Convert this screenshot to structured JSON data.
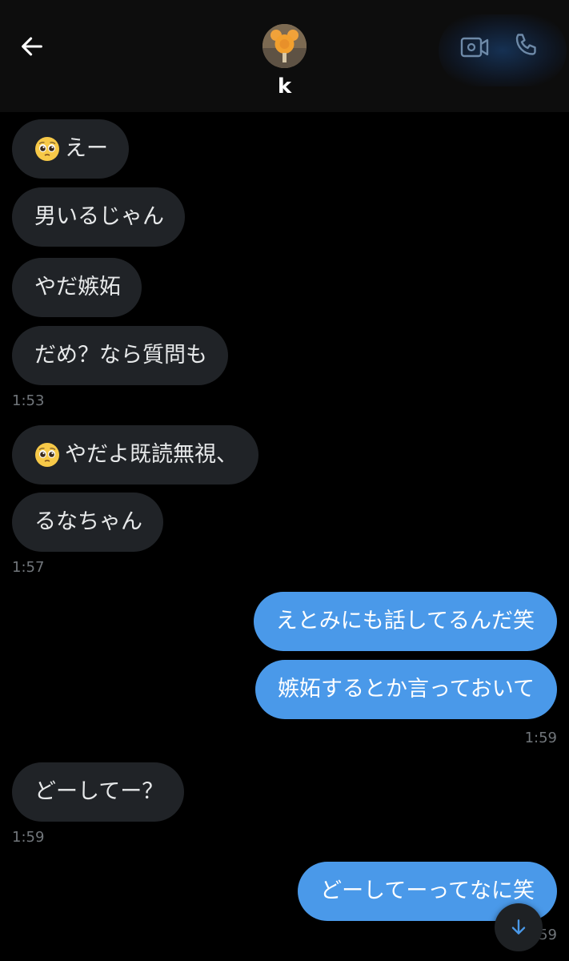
{
  "header": {
    "contact_name": "k",
    "back_icon": "arrow-left-icon",
    "video_icon": "video-camera-icon",
    "phone_icon": "phone-icon",
    "accent": "#4a99e9"
  },
  "messages": [
    {
      "direction": "in",
      "emoji": "pleading-face",
      "text": "えー"
    },
    {
      "direction": "in",
      "text": "男いるじゃん"
    },
    {
      "direction": "in",
      "text": "やだ嫉妬"
    },
    {
      "direction": "in",
      "text": "だめ？なら質問も"
    },
    {
      "direction": "in",
      "emoji": "pleading-face",
      "text": "やだよ既読無視、"
    },
    {
      "direction": "in",
      "text": "るなちゃん"
    },
    {
      "direction": "out",
      "text": "えとみにも話してるんだ笑"
    },
    {
      "direction": "out",
      "text": "嫉妬するとか言っておいて"
    },
    {
      "direction": "in",
      "text": "どーしてー？"
    },
    {
      "direction": "out",
      "text": "どーしてーってなに笑"
    }
  ],
  "timestamps": [
    "1:53",
    "1:57",
    "1:59",
    "1:59",
    "1:59"
  ],
  "scroll_button": {
    "icon": "arrow-down-icon"
  },
  "colors": {
    "background": "#000000",
    "incoming_bubble": "#202327",
    "outgoing_bubble": "#4a99e9",
    "timestamp": "#71767b"
  }
}
